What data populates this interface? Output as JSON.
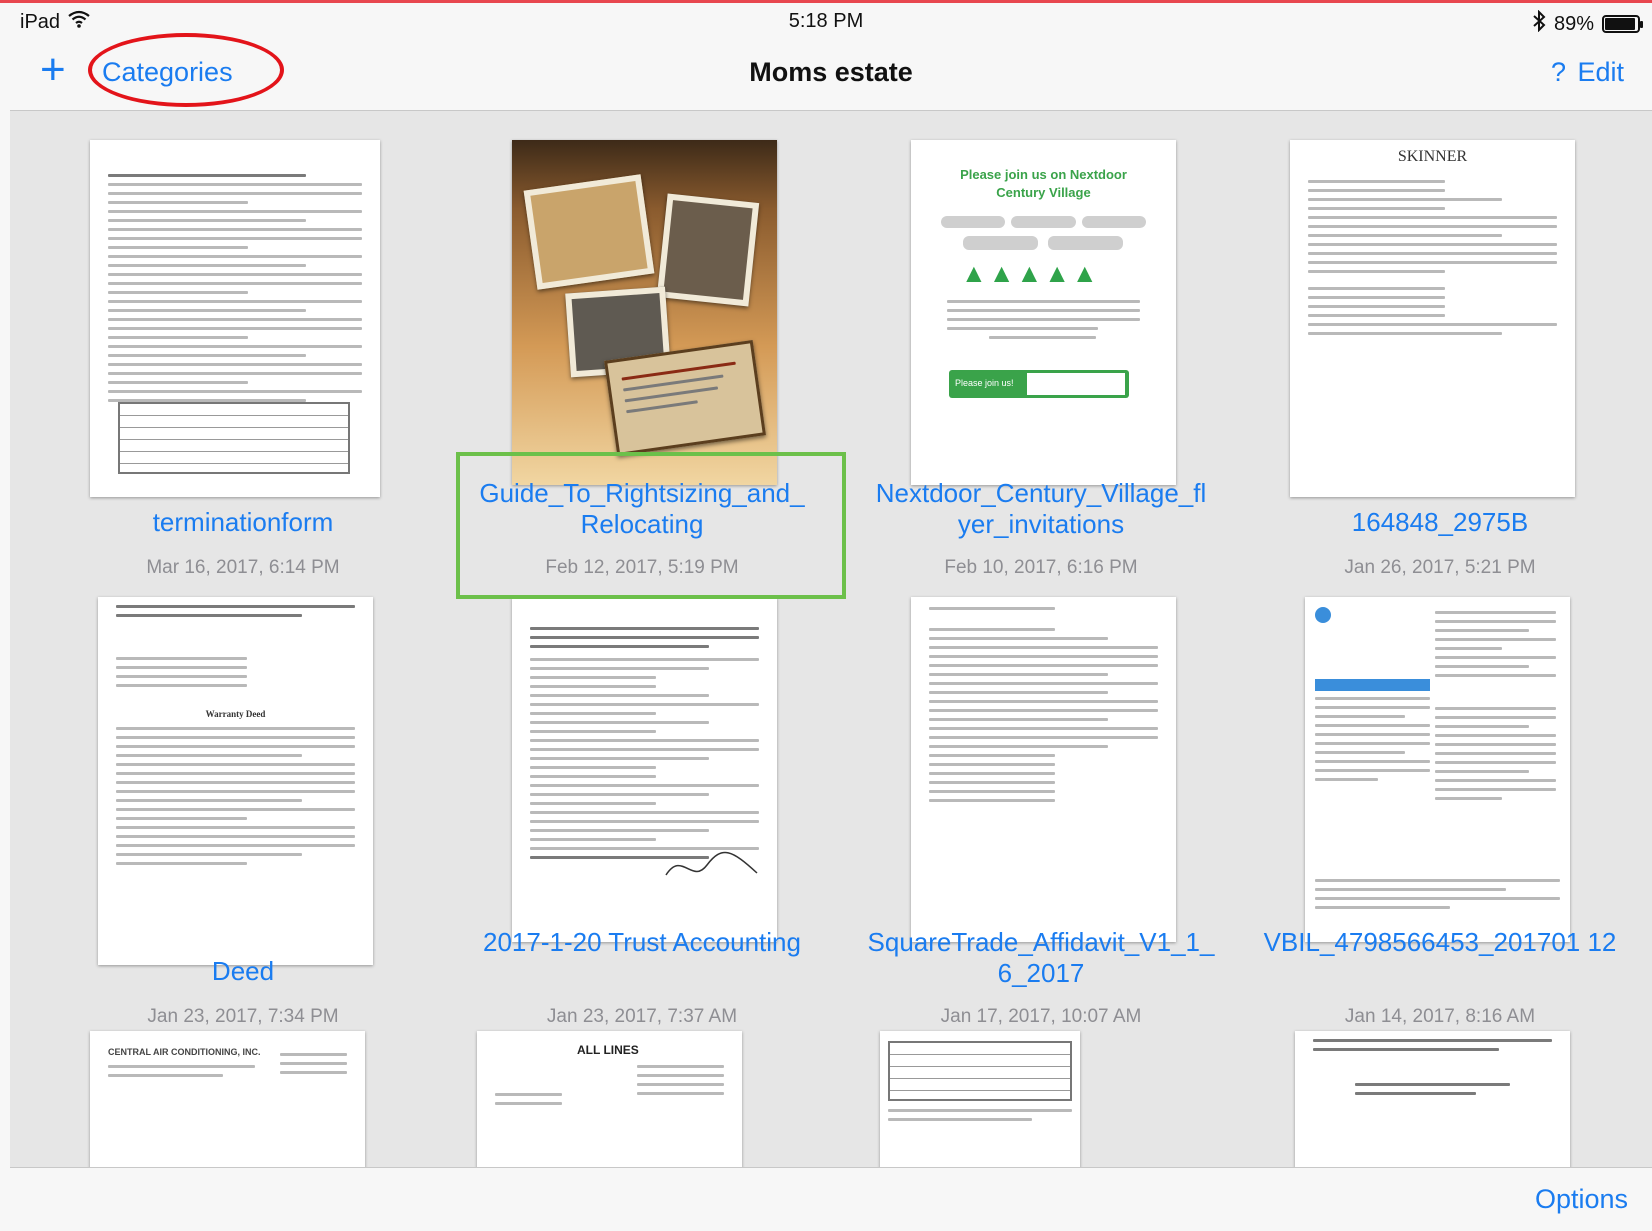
{
  "status_bar": {
    "device": "iPad",
    "time": "5:18 PM",
    "battery": "89%",
    "battery_level": 0.89,
    "icons": [
      "wifi-icon",
      "bluetooth-icon",
      "battery-icon"
    ]
  },
  "nav": {
    "add_label": "+",
    "categories_label": "Categories",
    "title": "Moms estate",
    "help_label": "?",
    "edit_label": "Edit"
  },
  "documents": [
    {
      "title": "terminationform",
      "date": "Mar 16, 2017, 6:14 PM"
    },
    {
      "title": "Guide_To_Rightsizing_and_ Relocating",
      "date": "Feb 12, 2017, 5:19 PM"
    },
    {
      "title": "Nextdoor_Century_Village_fl yer_invitations",
      "date": "Feb 10, 2017, 6:16 PM"
    },
    {
      "title": "164848_2975B",
      "date": "Jan 26, 2017, 5:21 PM"
    },
    {
      "title": "Deed",
      "date": "Jan 23, 2017, 7:34 PM"
    },
    {
      "title": "2017-1-20 Trust Accounting",
      "date": "Jan 23, 2017, 7:37 AM"
    },
    {
      "title": "SquareTrade_Affidavit_V1_1_ 6_2017",
      "date": "Jan 17, 2017, 10:07 AM"
    },
    {
      "title": "VBIL_4798566453_201701 12",
      "date": "Jan 14, 2017, 8:16 AM"
    }
  ],
  "thumb_text": {
    "skinner": "SKINNER",
    "nextdoor_line1": "Please join us on Nextdoor",
    "nextdoor_line2": "Century Village",
    "nextdoor_join": "Please join us!",
    "deed_heading": "Warranty Deed",
    "central_air": "CENTRAL AIR CONDITIONING, INC.",
    "all_lines": "ALL LINES"
  },
  "toolbar": {
    "options_label": "Options"
  },
  "colors": {
    "accent": "#1a7cf0",
    "highlight_green": "#6cc04a",
    "annotation_red": "#e3141a"
  }
}
